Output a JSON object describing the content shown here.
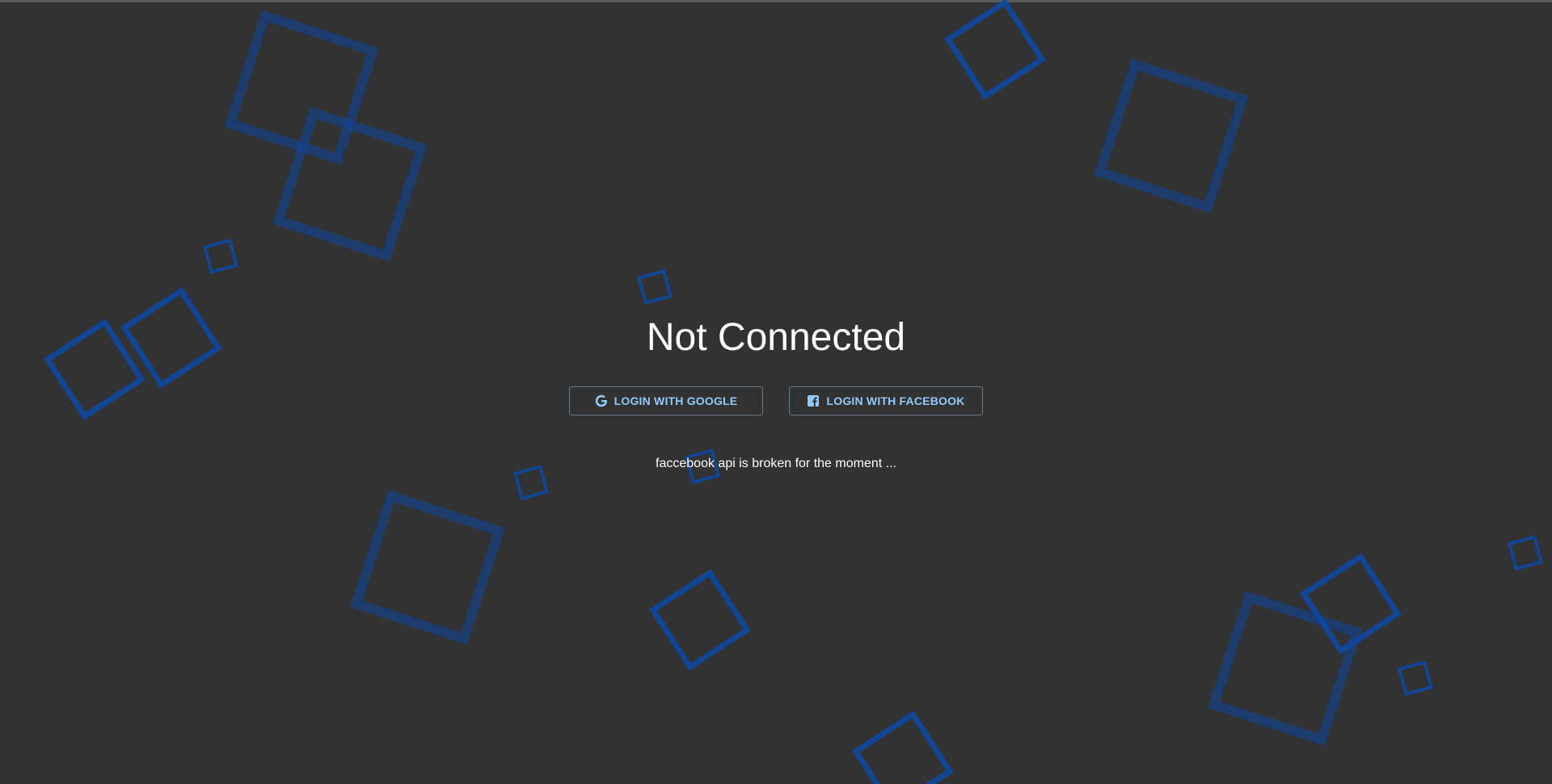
{
  "page": {
    "title": "Not Connected",
    "note": "faccebook api is broken for the moment ..."
  },
  "buttons": {
    "google": {
      "label": "LOGIN WITH GOOGLE",
      "icon": "google-icon"
    },
    "facebook": {
      "label": "LOGIN WITH FACEBOOK",
      "icon": "facebook-icon"
    }
  },
  "colors": {
    "background": "#323232",
    "accent": "#90caf9",
    "shapes": "#0d47a1"
  }
}
